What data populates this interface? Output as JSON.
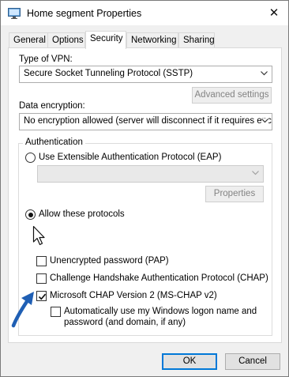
{
  "window": {
    "title": "Home segment Properties",
    "close_glyph": "✕"
  },
  "tabs": [
    {
      "label": "General"
    },
    {
      "label": "Options"
    },
    {
      "label": "Security"
    },
    {
      "label": "Networking"
    },
    {
      "label": "Sharing"
    }
  ],
  "active_tab": "Security",
  "vpn": {
    "type_label": "Type of VPN:",
    "type_value": "Secure Socket Tunneling Protocol (SSTP)",
    "advanced_label": "Advanced settings"
  },
  "encryption": {
    "label": "Data encryption:",
    "value": "No encryption allowed (server will disconnect if it requires encry"
  },
  "authentication": {
    "legend": "Authentication",
    "eap_label": "Use Extensible Authentication Protocol (EAP)",
    "eap_selected": false,
    "eap_combo_value": "",
    "properties_label": "Properties",
    "allow_label": "Allow these protocols",
    "allow_selected": true,
    "protocols": [
      {
        "label": "Unencrypted password (PAP)",
        "checked": false
      },
      {
        "label": "Challenge Handshake Authentication Protocol (CHAP)",
        "checked": false
      },
      {
        "label": "Microsoft CHAP Version 2 (MS-CHAP v2)",
        "checked": true
      }
    ],
    "auto_logon_line1": "Automatically use my Windows logon name and",
    "auto_logon_line2": "password (and domain, if any)",
    "auto_logon_checked": false
  },
  "footer": {
    "ok_label": "OK",
    "cancel_label": "Cancel"
  },
  "colors": {
    "accent": "#0078d7",
    "annotation_arrow": "#1f5fb4"
  },
  "icons": {
    "title": "network-connection-icon",
    "cursor": "mouse-pointer-icon",
    "annotation": "blue-annotation-arrow-icon"
  }
}
